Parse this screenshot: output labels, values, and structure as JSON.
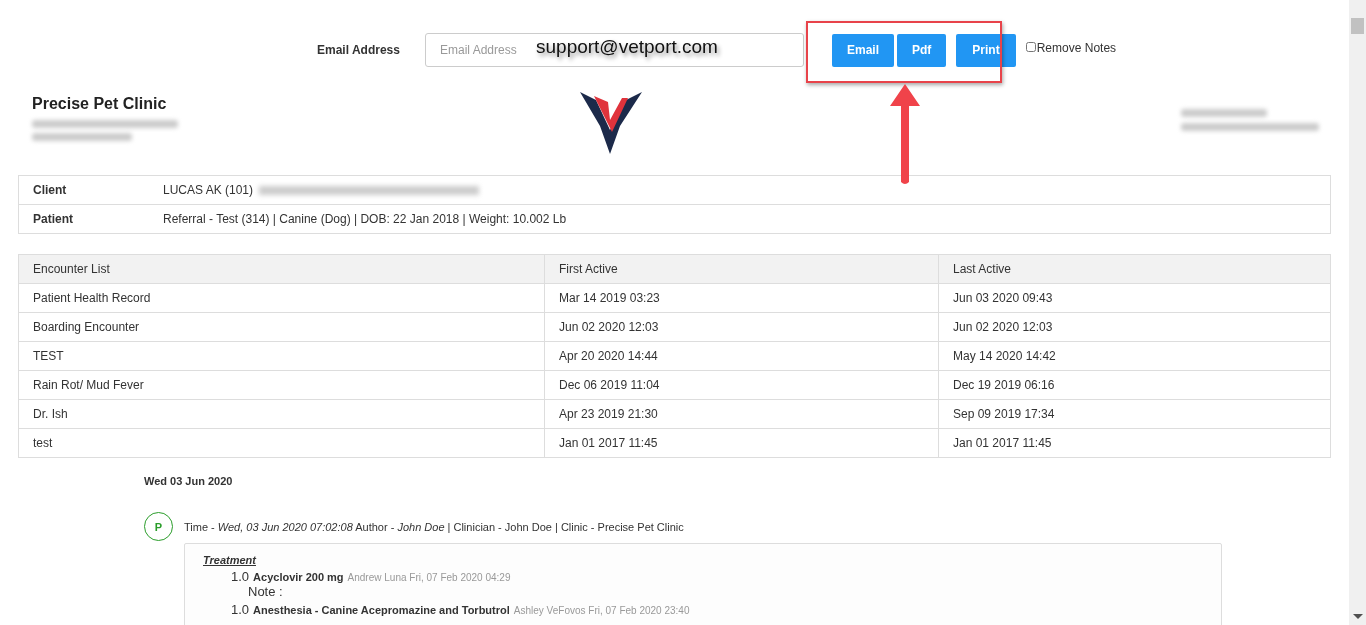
{
  "email_form": {
    "label": "Email Address",
    "placeholder": "Email Address",
    "buttons": [
      "Email",
      "Pdf",
      "Print"
    ],
    "remove_notes": {
      "label": "Remove Notes",
      "checked": false
    }
  },
  "annotation": {
    "overlay_text": "support@vetport.com"
  },
  "clinic": {
    "name": "Precise Pet Clinic"
  },
  "info": [
    {
      "label": "Client",
      "value": "LUCAS AK (101)"
    },
    {
      "label": "Patient",
      "value": "Referral - Test (314) | Canine (Dog) | DOB: 22 Jan 2018 | Weight: 10.002 Lb"
    }
  ],
  "encounters": {
    "columns": [
      "Encounter List",
      "First Active",
      "Last Active"
    ],
    "rows": [
      [
        "Patient Health Record",
        "Mar 14 2019 03:23",
        "Jun 03 2020 09:43"
      ],
      [
        "Boarding Encounter",
        "Jun 02 2020 12:03",
        "Jun 02 2020 12:03"
      ],
      [
        "TEST",
        "Apr 20 2020 14:44",
        "May 14 2020 14:42"
      ],
      [
        "Rain Rot/ Mud Fever",
        "Dec 06 2019 11:04",
        "Dec 19 2019 06:16"
      ],
      [
        "Dr. Ish",
        "Apr 23 2019 21:30",
        "Sep 09 2019 17:34"
      ],
      [
        "test",
        "Jan 01 2017 11:45",
        "Jan 01 2017 11:45"
      ]
    ]
  },
  "day": {
    "date": "Wed 03 Jun 2020",
    "entry": {
      "badge": "P",
      "meta": "Time - *Wed, 03 Jun 2020 07:02:08* Author - *John Doe* | Clinician - John Doe |  Clinic - Precise Pet Clinic",
      "section": "Treatment",
      "items": [
        {
          "qty": "1.0",
          "name": "Acyclovir 200 mg",
          "by": "Andrew Luna Fri, 07 Feb 2020 04:29",
          "note": "Note :"
        },
        {
          "qty": "1.0",
          "name": "Anesthesia - Canine Acepromazine and Torbutrol",
          "by": "Ashley VeFovos Fri, 07 Feb 2020 23:40"
        }
      ]
    }
  }
}
